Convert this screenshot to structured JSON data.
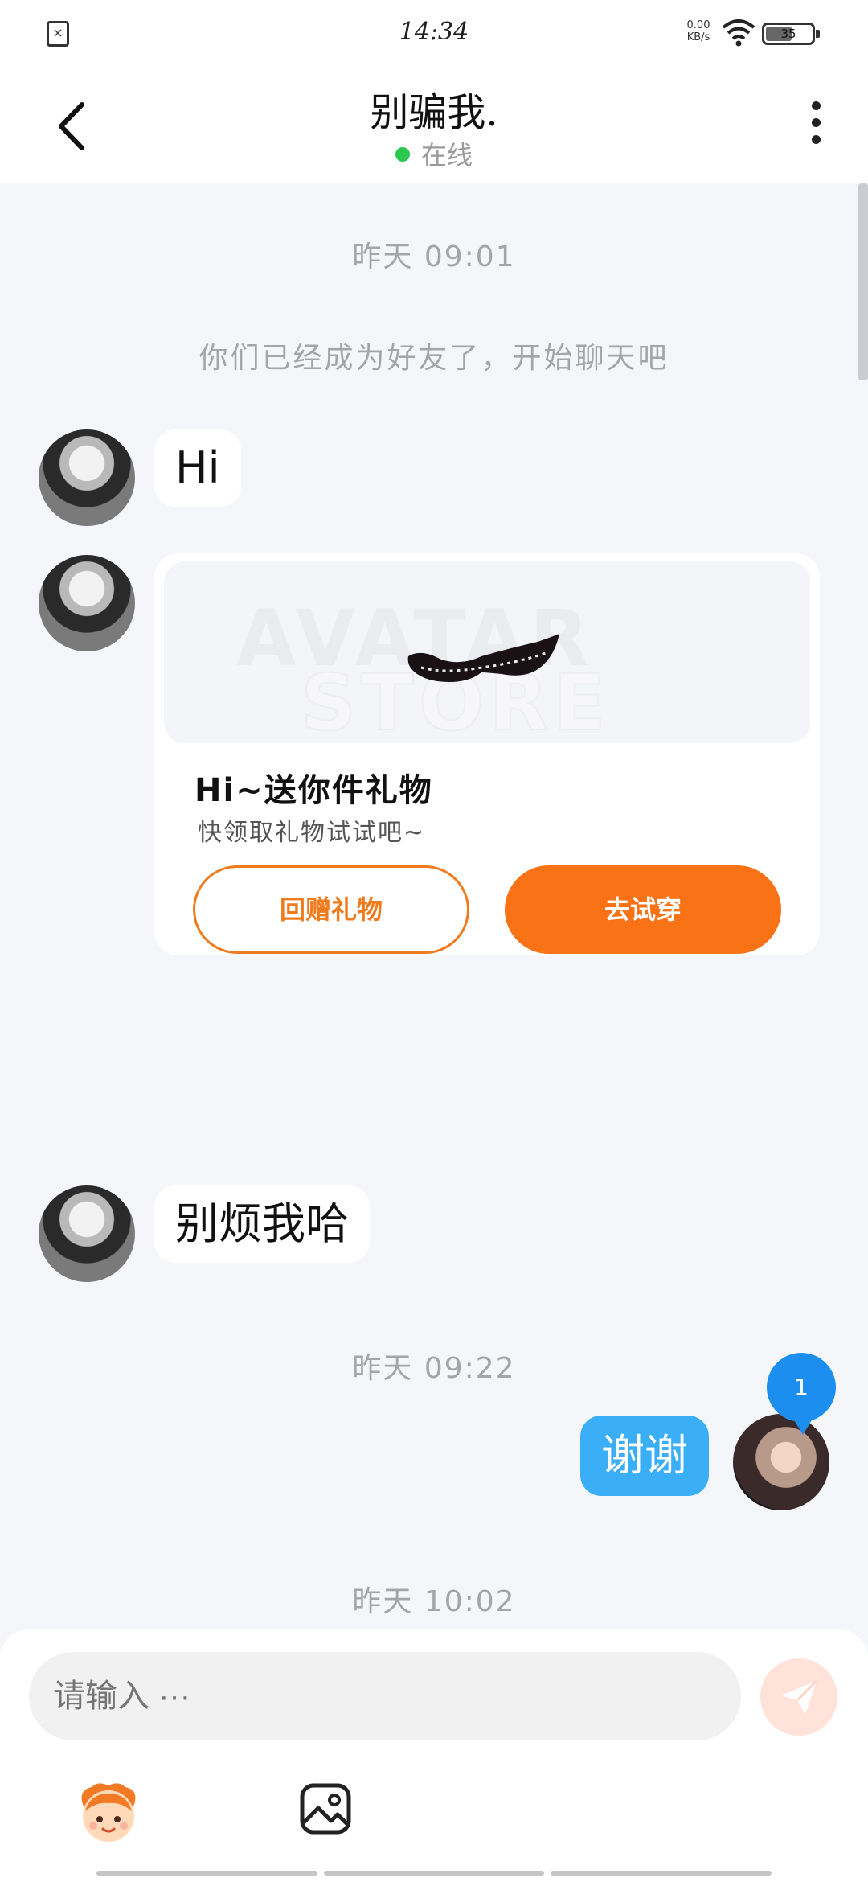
{
  "status_bar": {
    "time": "14:34",
    "network_speed": "0.00",
    "network_unit": "KB/s",
    "battery": "35"
  },
  "header": {
    "title": "别骗我.",
    "status": "在线",
    "status_color": "#2cc84d"
  },
  "chat": {
    "timestamps": [
      "昨天 09:01",
      "昨天 09:22",
      "昨天 10:02"
    ],
    "system_message": "你们已经成为好友了，开始聊天吧",
    "messages": [
      {
        "from": "other",
        "text": "Hi"
      },
      {
        "from": "other",
        "text": "别烦我哈"
      },
      {
        "from": "self",
        "text": "谢谢"
      }
    ],
    "gift_card": {
      "watermark_line1": "AVATAR",
      "watermark_line2": "STORE",
      "title": "Hi~送你件礼物",
      "subtitle": "快领取礼物试试吧~",
      "return_gift_label": "回赠礼物",
      "try_on_label": "去试穿"
    },
    "unread_count": "1"
  },
  "composer": {
    "placeholder": "请输入 ···",
    "accent": "#fa7216",
    "self_bubble_color": "#3aaef7"
  }
}
